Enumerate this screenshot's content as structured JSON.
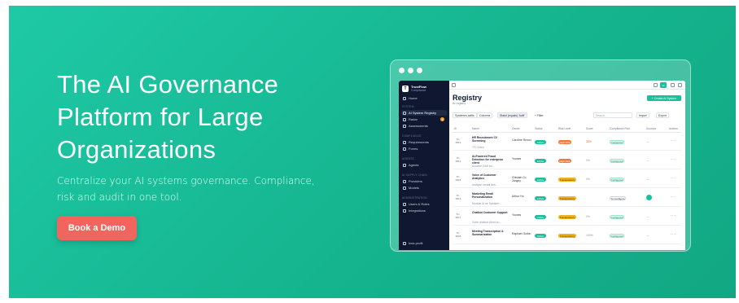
{
  "hero": {
    "headline": "The AI Governance Platform for Large Organizations",
    "subtext": "Centralize your AI systems governance. Compliance, risk and audit in one tool.",
    "cta_label": "Book a Demo",
    "background_color": "#1fc9a6",
    "cta_color": "#f0665f"
  },
  "app": {
    "brand": {
      "name": "TrustFlow",
      "sub": "Compliance",
      "logo_letter": "T"
    },
    "sidebar": {
      "home": "Home",
      "sections": [
        {
          "label": "SYSTEM",
          "items": [
            "AI System Registry",
            "Radar",
            "Assessments"
          ]
        },
        {
          "label": "COMPLIANCE",
          "items": [
            "Requirements",
            "Forms"
          ]
        },
        {
          "label": "AGENTS",
          "items": [
            "Agents"
          ]
        },
        {
          "label": "AI SUPPLY CHAIN",
          "items": [
            "Providers",
            "Models"
          ]
        },
        {
          "label": "ADMINISTRATION",
          "items": [
            "Users & Roles",
            "Integrations"
          ]
        }
      ],
      "radar_badge": "3",
      "footer_user": "Ines profil"
    },
    "topbar": {
      "avatar_label": "AI"
    },
    "page": {
      "title": "Registry",
      "breadcrumb": "AI registry",
      "create_button": "+ Create AI System"
    },
    "filters": {
      "systems": "Systèmes actifs",
      "columns": "Columns",
      "active_filter": "Statut (equals) 'Actif'",
      "add_filter": "+ Filter",
      "search_placeholder": "Search...",
      "import": "Import",
      "export": "Export"
    },
    "table": {
      "columns": [
        "ID",
        "Name",
        "Owner",
        "Status",
        "Risk Level",
        "Score",
        "Compliance Plan",
        "Sources",
        "Actions"
      ],
      "rows": [
        {
          "id_prefix": "TF-",
          "id": "6812",
          "name": "HR Recruitment CV Screening",
          "sub": "TG Criteo",
          "owner": "Caroline Renou",
          "status": "Active",
          "risk": "High Risk",
          "risk_type": "high",
          "score": "35%",
          "plan": "Configured",
          "sources": "—",
          "actions": "···"
        },
        {
          "id_prefix": "TF-",
          "id": "6813",
          "name": "AI-Powered Fraud Detection for enterprise client",
          "sub": "Solution RAS bs...",
          "owner": "Younes",
          "status": "Active",
          "risk": "High Risk",
          "risk_type": "high",
          "score": "0%",
          "plan": "Configured",
          "sources": "—",
          "actions": "···"
        },
        {
          "id_prefix": "TF-",
          "id": "6815",
          "name": "Voice of Customer Analytics",
          "sub": "Analyse verbal des...",
          "owner": "Ghislain Co Jongny",
          "status": "Active",
          "risk": "Transparency",
          "risk_type": "transp",
          "score": "0%",
          "plan": "Configured",
          "sources": "—",
          "actions": "···"
        },
        {
          "id_prefix": "TF-",
          "id": "6816",
          "name": "Marketing Email Personalization",
          "sub": "Module IA de Speaker...",
          "owner": "Arthur Ho",
          "status": "Active",
          "risk": "Transparency",
          "risk_type": "transp",
          "score": "",
          "plan": "To Configure",
          "sources": "dot",
          "actions": "···"
        },
        {
          "id_prefix": "TF-",
          "id": "6817",
          "name": "Chatbot Customer Support",
          "sub": "Votre chatbot client su...",
          "owner": "Younes",
          "status": "Active",
          "risk": "Transparency",
          "risk_type": "transp",
          "score": "0%",
          "plan": "Configured",
          "sources": "—",
          "actions": "···"
        },
        {
          "id_prefix": "TF-",
          "id": "6818",
          "name": "Meeting Transcription & Summarization",
          "sub": "",
          "owner": "Raphael Gullon",
          "status": "Active",
          "risk": "Transparency",
          "risk_type": "transp",
          "score": "100%",
          "plan": "Configured",
          "sources": "—",
          "actions": "···"
        }
      ]
    }
  }
}
